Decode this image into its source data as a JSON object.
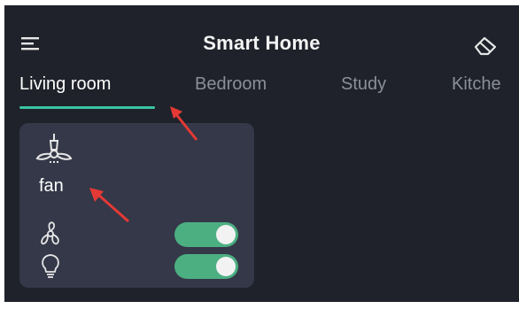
{
  "app": {
    "title": "Smart Home"
  },
  "header": {
    "menu_icon": "menu-icon",
    "eraser_icon": "eraser-icon"
  },
  "tabs": [
    {
      "label": "Living room",
      "active": true
    },
    {
      "label": "Bedroom",
      "active": false
    },
    {
      "label": "Study",
      "active": false
    },
    {
      "label": "Kitche",
      "active": false
    }
  ],
  "device": {
    "name": "fan",
    "icon": "ceiling-fan-icon",
    "controls": [
      {
        "icon": "fan-blade-icon",
        "on": true
      },
      {
        "icon": "light-bulb-icon",
        "on": true
      }
    ]
  },
  "colors": {
    "background": "#1f222a",
    "card": "#343848",
    "accent": "#3cc4a4",
    "toggle_on": "#4caf82",
    "annotation_arrow": "#e53935"
  }
}
